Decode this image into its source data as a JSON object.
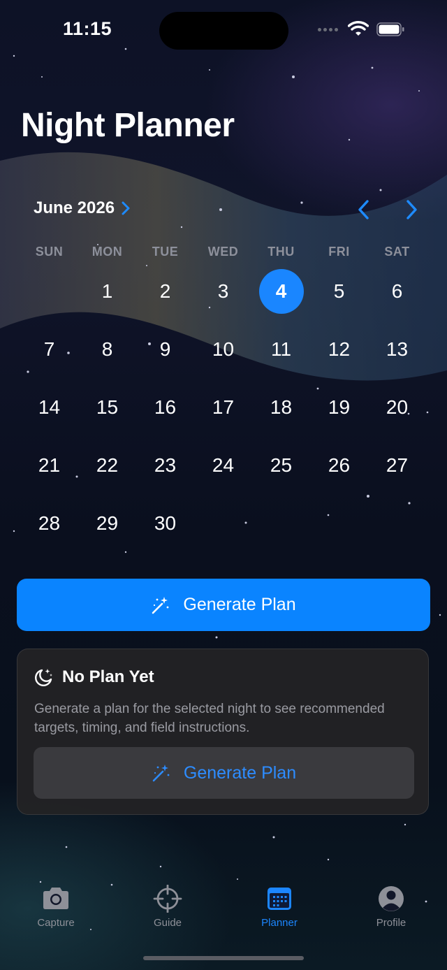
{
  "status_bar": {
    "time": "11:15"
  },
  "header": {
    "title": "Night Planner"
  },
  "calendar": {
    "month_label": "June 2026",
    "weekdays": [
      "SUN",
      "MON",
      "TUE",
      "WED",
      "THU",
      "FRI",
      "SAT"
    ],
    "leading_blanks": 1,
    "days": [
      "1",
      "2",
      "3",
      "4",
      "5",
      "6",
      "7",
      "8",
      "9",
      "10",
      "11",
      "12",
      "13",
      "14",
      "15",
      "16",
      "17",
      "18",
      "19",
      "20",
      "21",
      "22",
      "23",
      "24",
      "25",
      "26",
      "27",
      "28",
      "29",
      "30"
    ],
    "selected_day": "4"
  },
  "actions": {
    "generate_label": "Generate Plan"
  },
  "empty_state": {
    "title": "No Plan Yet",
    "description": "Generate a plan for the selected night to see recommended targets, timing, and field instructions.",
    "button_label": "Generate Plan"
  },
  "tabbar": {
    "items": [
      {
        "label": "Capture",
        "icon": "camera-icon",
        "active": false
      },
      {
        "label": "Guide",
        "icon": "crosshair-icon",
        "active": false
      },
      {
        "label": "Planner",
        "icon": "calendar-icon",
        "active": true
      },
      {
        "label": "Profile",
        "icon": "person-circle-icon",
        "active": false
      }
    ]
  },
  "colors": {
    "accent": "#0a84ff",
    "card_bg": "#222224",
    "secondary_button_bg": "#3a3a3e"
  }
}
